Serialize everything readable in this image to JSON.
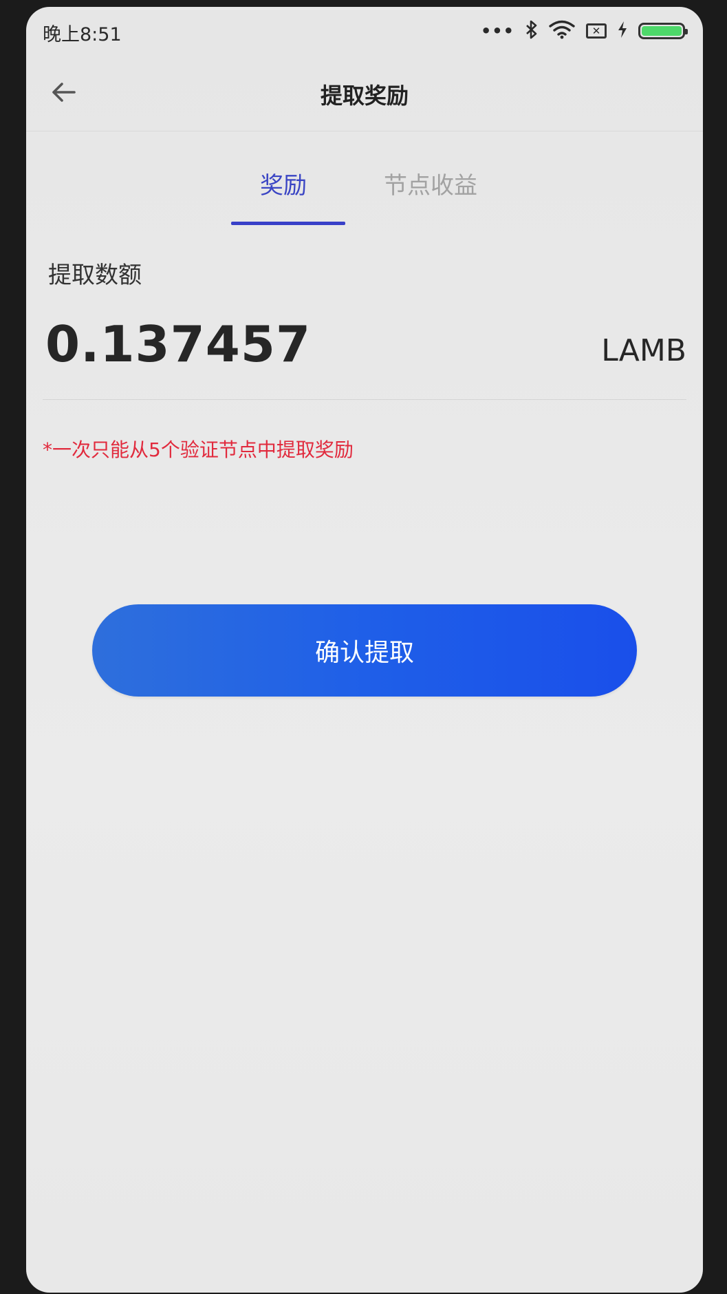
{
  "status_bar": {
    "time": "晚上8:51",
    "dots": "•••",
    "bluetooth_icon": "bluetooth-icon",
    "wifi_icon": "wifi-icon",
    "sim_icon": "sim-no-signal-icon",
    "charging_icon": "charging-bolt-icon",
    "battery_icon": "battery-icon",
    "battery_level": 1.0,
    "battery_color": "#4ed86a"
  },
  "header": {
    "back_icon": "arrow-left-icon",
    "title": "提取奖励"
  },
  "tabs": [
    {
      "label": "奖励",
      "active": true
    },
    {
      "label": "节点收益",
      "active": false
    }
  ],
  "amount": {
    "label": "提取数额",
    "value": "0.137457",
    "unit": "LAMB"
  },
  "notice": "*一次只能从5个验证节点中提取奖励",
  "confirm_button": {
    "label": "确认提取"
  },
  "colors": {
    "accent": "#3840c8",
    "button": "#1f5fe8",
    "warning": "#e12a3d"
  }
}
